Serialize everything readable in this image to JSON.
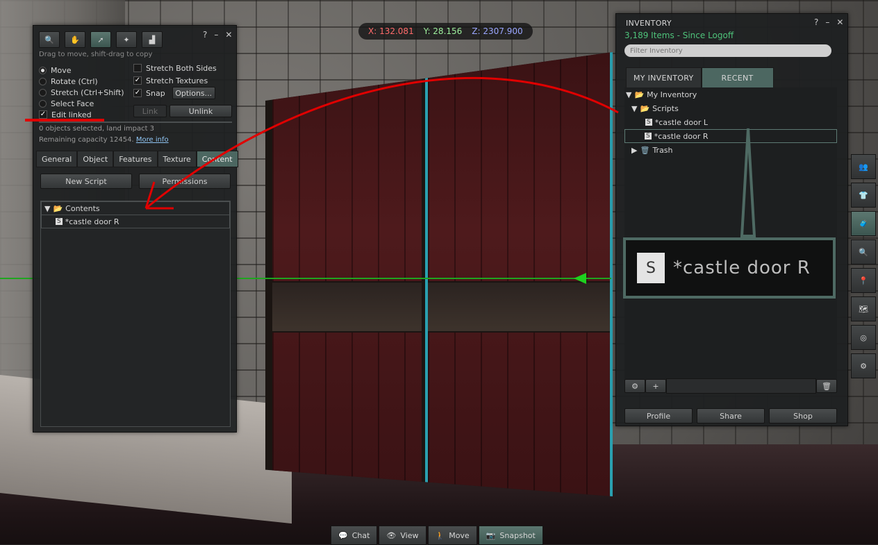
{
  "coords": {
    "x": "X: 132.081",
    "y": "Y: 28.156",
    "z": "Z: 2307.900"
  },
  "build": {
    "help": "?",
    "minimize": "–",
    "close": "✕",
    "hint": "Drag to move, shift-drag to copy",
    "modes": [
      {
        "label": "Move",
        "selected": true
      },
      {
        "label": "Rotate (Ctrl)",
        "selected": false
      },
      {
        "label": "Stretch (Ctrl+Shift)",
        "selected": false
      },
      {
        "label": "Select Face",
        "selected": false
      }
    ],
    "edit_linked": {
      "label": "Edit linked",
      "checked": true
    },
    "stretch_both": {
      "label": "Stretch Both Sides",
      "checked": false
    },
    "stretch_textures": {
      "label": "Stretch Textures",
      "checked": true
    },
    "snap": {
      "label": "Snap",
      "checked": true
    },
    "options_button": "Options...",
    "link_button": "Link",
    "unlink_button": "Unlink",
    "selection_info": "0 objects selected, land impact 3",
    "capacity_info": "Remaining capacity 12454.",
    "more_info": "More info",
    "tabs": [
      "General",
      "Object",
      "Features",
      "Texture",
      "Content"
    ],
    "new_script_button": "New Script",
    "permissions_button": "Permissions",
    "contents_folder": "Contents",
    "contents_item": "*castle door R"
  },
  "inventory": {
    "title": "INVENTORY",
    "help": "?",
    "minimize": "–",
    "close": "✕",
    "count": "3,189 Items",
    "since": "- Since Logoff",
    "filter_placeholder": "Filter Inventory",
    "tabs": [
      "MY INVENTORY",
      "RECENT"
    ],
    "tree": {
      "root": "My Inventory",
      "scripts_folder": "Scripts",
      "item1": "*castle door L",
      "item2": "*castle door R",
      "trash": "Trash"
    },
    "zoom_label": "*castle door R",
    "bottom_buttons": [
      "Profile",
      "Share",
      "Shop"
    ]
  },
  "bottombar": {
    "chat": "Chat",
    "view": "View",
    "move": "Move",
    "snapshot": "Snapshot"
  },
  "colors": {
    "accent": "#4c6761",
    "annotation": "#e00000",
    "green_text": "#4ec27a"
  }
}
